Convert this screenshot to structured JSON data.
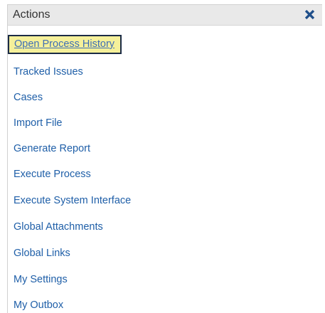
{
  "panel": {
    "title": "Actions",
    "close_icon": "close-x-icon"
  },
  "menu": {
    "items": [
      {
        "label": "Open Process History",
        "active": true
      },
      {
        "label": "Tracked Issues"
      },
      {
        "label": "Cases"
      },
      {
        "label": "Import File"
      },
      {
        "label": "Generate Report"
      },
      {
        "label": "Execute Process"
      },
      {
        "label": "Execute System Interface"
      },
      {
        "label": "Global Attachments"
      },
      {
        "label": "Global Links"
      },
      {
        "label": "My Settings"
      },
      {
        "label": "My Outbox"
      }
    ]
  },
  "colors": {
    "link": "#1f5fa8",
    "header_bg": "#e9e9e9",
    "active_bg": "#f5f09a",
    "active_border": "#1b2b45",
    "close_icon": "#1f4f8a"
  }
}
